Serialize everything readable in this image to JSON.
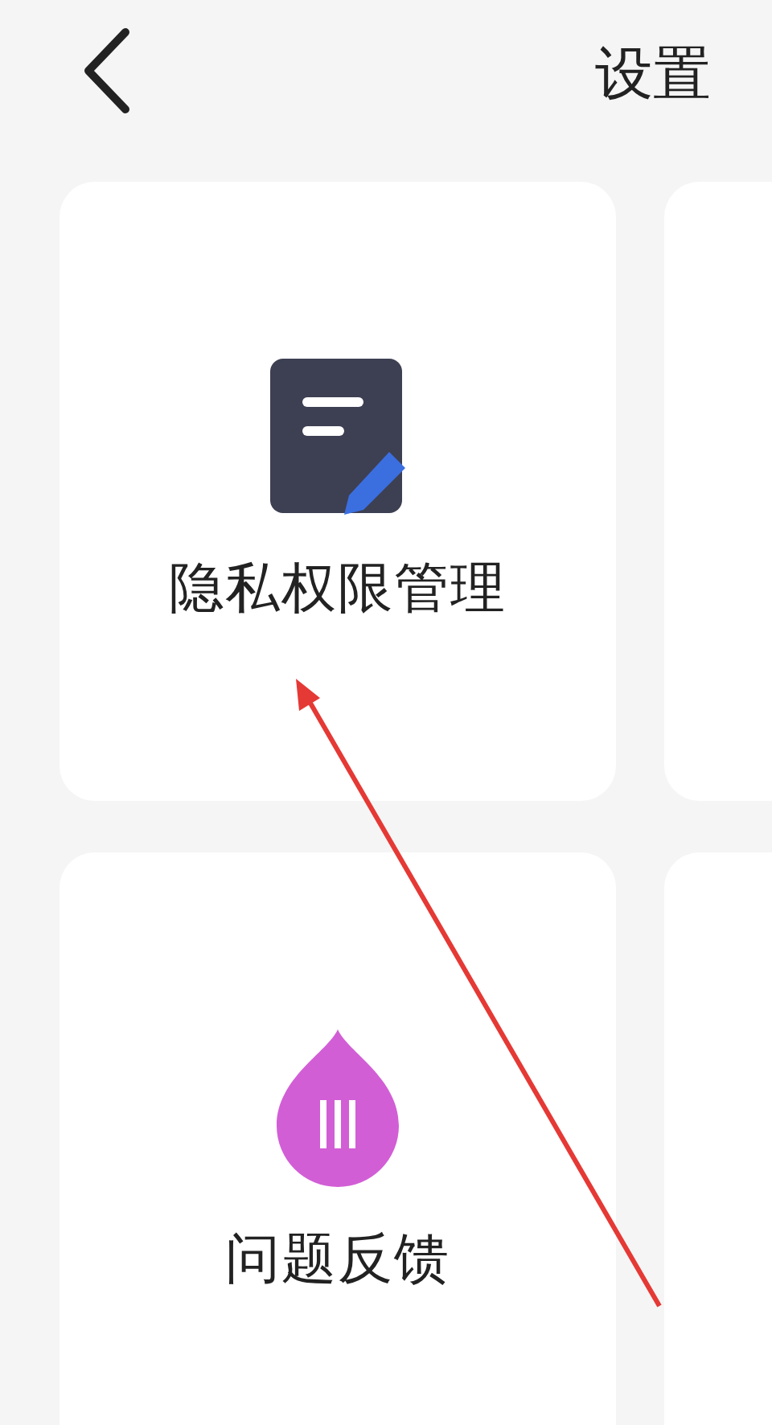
{
  "header": {
    "title": "设置"
  },
  "rows": [
    {
      "cards": [
        {
          "kind": "item",
          "label": "隐私权限管理"
        },
        {
          "kind": "cut"
        }
      ]
    },
    {
      "cards": [
        {
          "kind": "item",
          "label": "问题反馈"
        },
        {
          "kind": "cut"
        }
      ]
    }
  ],
  "annotation": {
    "kind": "arrow"
  }
}
